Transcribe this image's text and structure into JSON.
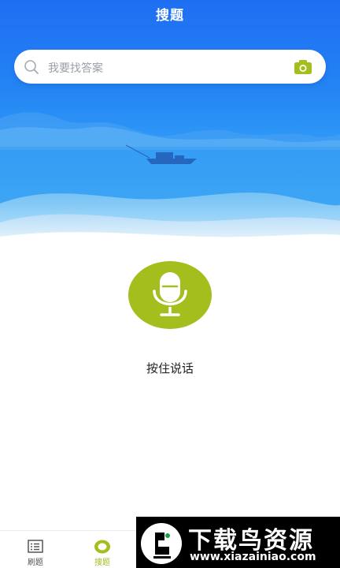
{
  "header": {
    "title": "搜题"
  },
  "search": {
    "placeholder": "我要找答案",
    "left_icon": "search-icon",
    "right_icon": "camera-icon"
  },
  "voice": {
    "icon": "microphone-icon",
    "hint": "按住说话",
    "accent": "#a3be1d"
  },
  "tabs": [
    {
      "label": "刷题",
      "icon": "list-icon",
      "active": false
    },
    {
      "label": "搜题",
      "icon": "search-tab-icon",
      "active": true
    }
  ],
  "watermark": {
    "title": "下载鸟资源",
    "url": "www.xiazainiao.com"
  },
  "colors": {
    "header_blue": "#1f6ef2",
    "accent_green": "#a3be1d"
  }
}
